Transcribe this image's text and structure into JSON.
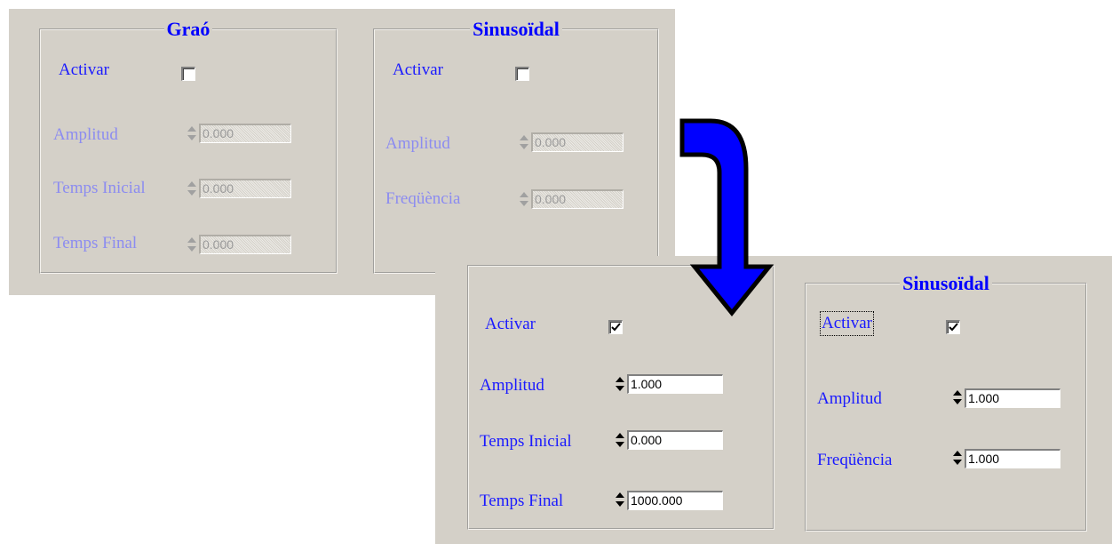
{
  "top": {
    "grao": {
      "title": "Graó",
      "activar": "Activar",
      "activar_checked": false,
      "fields": [
        {
          "label": "Amplitud",
          "value": "0.000"
        },
        {
          "label": "Temps Inicial",
          "value": "0.000"
        },
        {
          "label": "Temps Final",
          "value": "0.000"
        }
      ]
    },
    "sin": {
      "title": "Sinusoïdal",
      "activar": "Activar",
      "activar_checked": false,
      "fields": [
        {
          "label": "Amplitud",
          "value": "0.000"
        },
        {
          "label": "Freqüència",
          "value": "0.000"
        }
      ]
    }
  },
  "bottom": {
    "grao": {
      "activar": "Activar",
      "activar_checked": true,
      "fields": [
        {
          "label": "Amplitud",
          "value": "1.000"
        },
        {
          "label": "Temps Inicial",
          "value": "0.000"
        },
        {
          "label": "Temps Final",
          "value": "1000.000"
        }
      ]
    },
    "sin": {
      "title": "Sinusoïdal",
      "activar": "Activar",
      "activar_checked": true,
      "fields": [
        {
          "label": "Amplitud",
          "value": "1.000"
        },
        {
          "label": "Freqüència",
          "value": "1.000"
        }
      ]
    }
  },
  "colors": {
    "panel_bg": "#d4d0c8",
    "label": "#1a1aff",
    "label_disabled": "#8c8cf0",
    "arrow": "#0000ff"
  },
  "icons": [
    "checkbox-checkmark-icon",
    "spinner-arrows-icon",
    "curved-down-arrow-icon"
  ]
}
